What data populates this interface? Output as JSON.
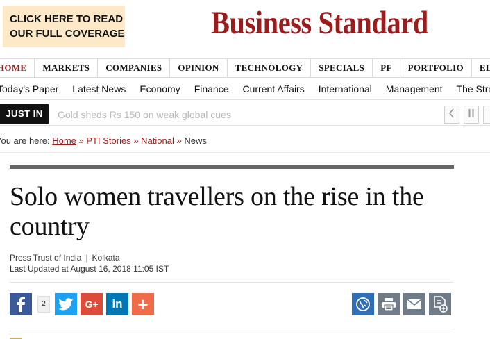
{
  "promo": {
    "line1": "CLICK HERE TO READ",
    "line2": "OUR FULL COVERAGE"
  },
  "brand": {
    "name": "Business Standard",
    "color": "#9b1c1c"
  },
  "nav": {
    "items": [
      "HOME",
      "MARKETS",
      "COMPANIES",
      "OPINION",
      "TECHNOLOGY",
      "SPECIALS",
      "PF",
      "PORTFOLIO",
      "ELECT"
    ],
    "active": "HOME"
  },
  "subnav": {
    "items": [
      "Today's Paper",
      "Latest News",
      "Economy",
      "Finance",
      "Current Affairs",
      "International",
      "Management",
      "The Stra"
    ]
  },
  "ticker": {
    "label": "JUST IN",
    "text": "Gold sheds Rs 150 on weak global cues",
    "prev_icon": "chevron-left-icon",
    "pause_icon": "pause-icon"
  },
  "breadcrumb": {
    "prefix": "You are here:",
    "home": "Home",
    "sep1": "»",
    "pti": "PTI Stories",
    "sep2": "»",
    "national": "National",
    "sep3": "»",
    "current": "News"
  },
  "article": {
    "headline": "Solo women travellers on the rise in the country",
    "source": "Press Trust of India",
    "separator": "|",
    "location": "Kolkata",
    "updated": "Last Updated at August 16, 2018 11:05 IST"
  },
  "share": {
    "facebook_count": "2",
    "buttons": [
      {
        "name": "facebook-icon",
        "glyph": "f",
        "color": "#3b5998"
      },
      {
        "name": "twitter-icon",
        "color": "#1da1f2"
      },
      {
        "name": "google-plus-icon",
        "glyph": "G+",
        "color": "#dd4b39"
      },
      {
        "name": "linkedin-icon",
        "glyph": "in",
        "color": "#0077b5"
      },
      {
        "name": "more-plus-icon",
        "glyph": "+",
        "color": "#f06b4a"
      }
    ],
    "tools": [
      {
        "name": "translate-globe-icon",
        "color": "#2f6fb5"
      },
      {
        "name": "print-icon",
        "color": "#6f7b86"
      },
      {
        "name": "email-icon",
        "color": "#6f7b86"
      },
      {
        "name": "save-document-icon",
        "color": "#6f7b86"
      }
    ]
  }
}
